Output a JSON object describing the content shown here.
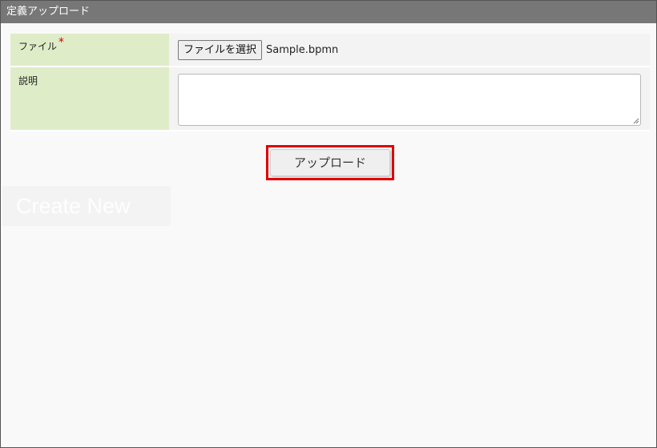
{
  "dialog": {
    "title": "定義アップロード"
  },
  "form": {
    "file_label": "ファイル",
    "required_mark": "*",
    "file_button_label": "ファイルを選択",
    "file_name": "Sample.bpmn",
    "description_label": "説明",
    "description_value": ""
  },
  "actions": {
    "upload_label": "アップロード"
  },
  "background": {
    "create_new_label": "Create New"
  },
  "colors": {
    "titlebar": "#777777",
    "label_cell": "#dfecc8",
    "highlight": "#e00000",
    "required": "#dd0000"
  }
}
